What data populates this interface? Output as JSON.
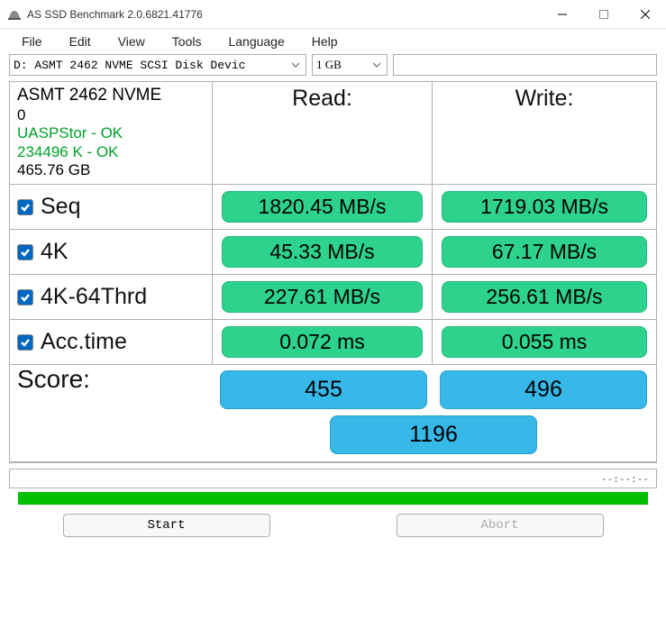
{
  "window": {
    "title": "AS SSD Benchmark 2.0.6821.41776"
  },
  "menu": {
    "file": "File",
    "edit": "Edit",
    "view": "View",
    "tools": "Tools",
    "language": "Language",
    "help": "Help"
  },
  "controls": {
    "drive_selected": "D: ASMT 2462 NVME SCSI Disk Devic",
    "size_selected": "1 GB"
  },
  "info": {
    "device": "ASMT 2462 NVME",
    "index": "0",
    "driver_ok": "UASPStor - OK",
    "align_ok": "234496 K - OK",
    "capacity": "465.76 GB"
  },
  "headers": {
    "read": "Read:",
    "write": "Write:"
  },
  "tests": {
    "seq": {
      "label": "Seq",
      "checked": true,
      "read": "1820.45 MB/s",
      "write": "1719.03 MB/s"
    },
    "k4": {
      "label": "4K",
      "checked": true,
      "read": "45.33 MB/s",
      "write": "67.17 MB/s"
    },
    "k4_64": {
      "label": "4K-64Thrd",
      "checked": true,
      "read": "227.61 MB/s",
      "write": "256.61 MB/s"
    },
    "acc": {
      "label": "Acc.time",
      "checked": true,
      "read": "0.072 ms",
      "write": "0.055 ms"
    }
  },
  "score": {
    "label": "Score:",
    "read": "455",
    "write": "496",
    "total": "1196"
  },
  "progress": {
    "text": "--:--:--"
  },
  "buttons": {
    "start": "Start",
    "abort": "Abort"
  }
}
